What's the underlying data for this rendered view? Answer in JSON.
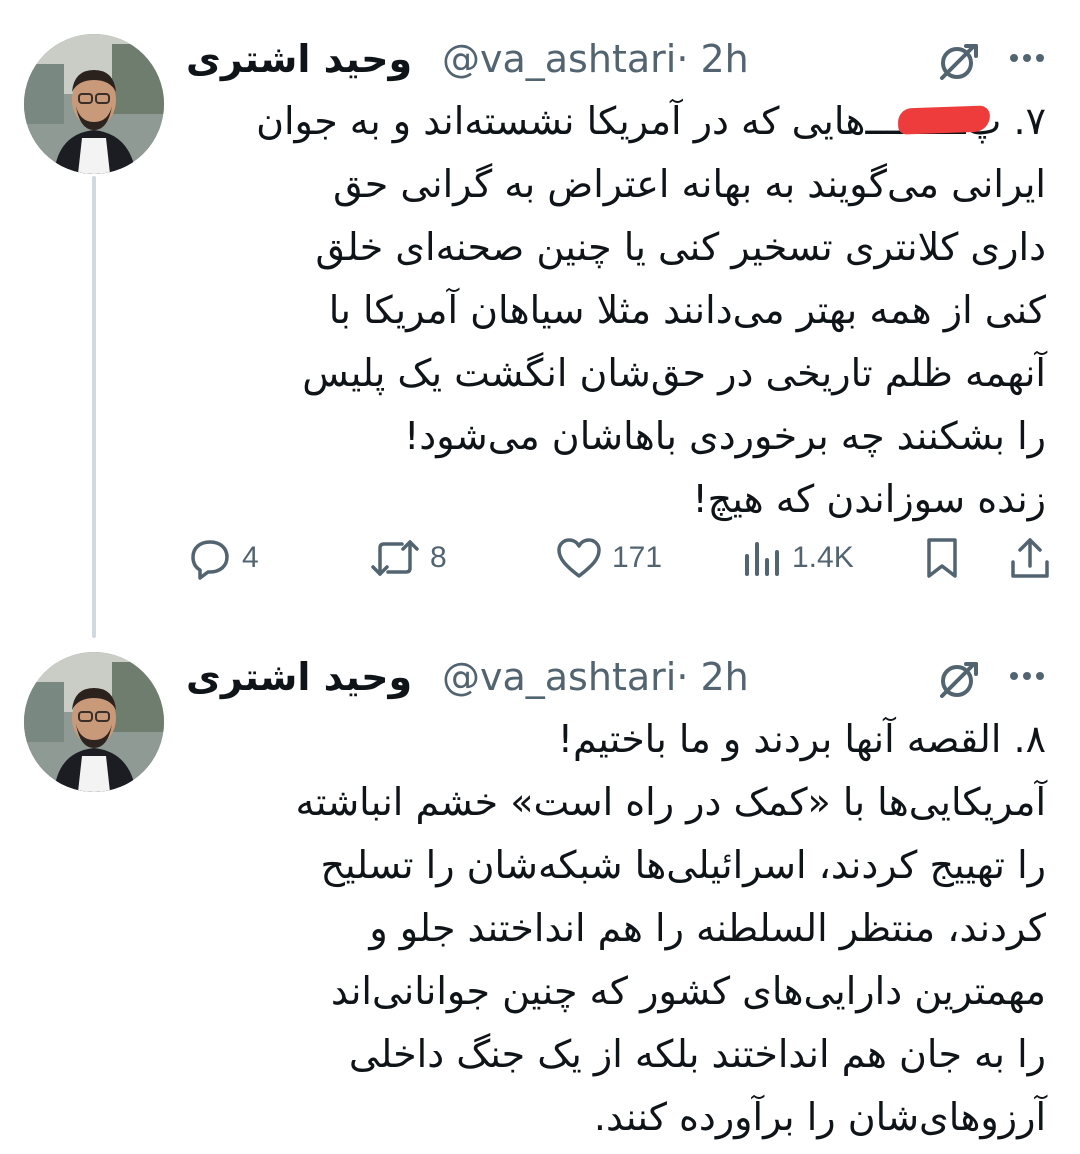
{
  "thread": [
    {
      "display_name": "وحید اشتری",
      "handle": "@va_ashtari",
      "time": "· 2h",
      "text": "۷. پ‌ـــــــــ‌هایی که در آمریکا نشسته‌اند و به جوان\nایرانی می‌گویند به بهانه اعتراض به گرانی حق\nداری کلانتری تسخیر کنی یا چنین صحنه‌ای خلق\nکنی از همه بهتر می‌دانند مثلا سیاهان آمریکا با\nآنهمه ظلم تاریخی در حق‌شان انگشت یک پلیس\nرا بشکنند چه برخوردی باهاشان می‌شود!\nزنده سوزاندن که هیچ!",
      "metrics": {
        "replies": "4",
        "retweets": "8",
        "likes": "171",
        "views": "1.4K"
      }
    },
    {
      "display_name": "وحید اشتری",
      "handle": "@va_ashtari",
      "time": "· 2h",
      "text": "۸. القصه آنها بردند و ما باختیم!\nآمریکایی‌ها با «کمک در راه است» خشم انباشته\nرا تهییج کردند، اسرائیلی‌ها شبکه‌شان را تسلیح\nکردند، منتظر السلطنه را هم انداختند جلو و\nمهمترین دارایی‌های کشور که چنین جوانانی‌اند\nرا به جان هم انداختند بلکه از یک جنگ داخلی\nآرزوهای‌شان را برآورده کنند."
    }
  ],
  "icons": {
    "grok": "grok-slash-circle-icon",
    "more": "more-dots-icon",
    "reply": "reply-bubble-icon",
    "retweet": "retweet-icon",
    "like": "heart-icon",
    "views": "views-bars-icon",
    "bookmark": "bookmark-icon",
    "share": "share-upload-icon"
  },
  "colors": {
    "text": "#0f1419",
    "secondary": "#536471",
    "thread_line": "#cfd9de",
    "redaction": "#ee3b3b"
  }
}
